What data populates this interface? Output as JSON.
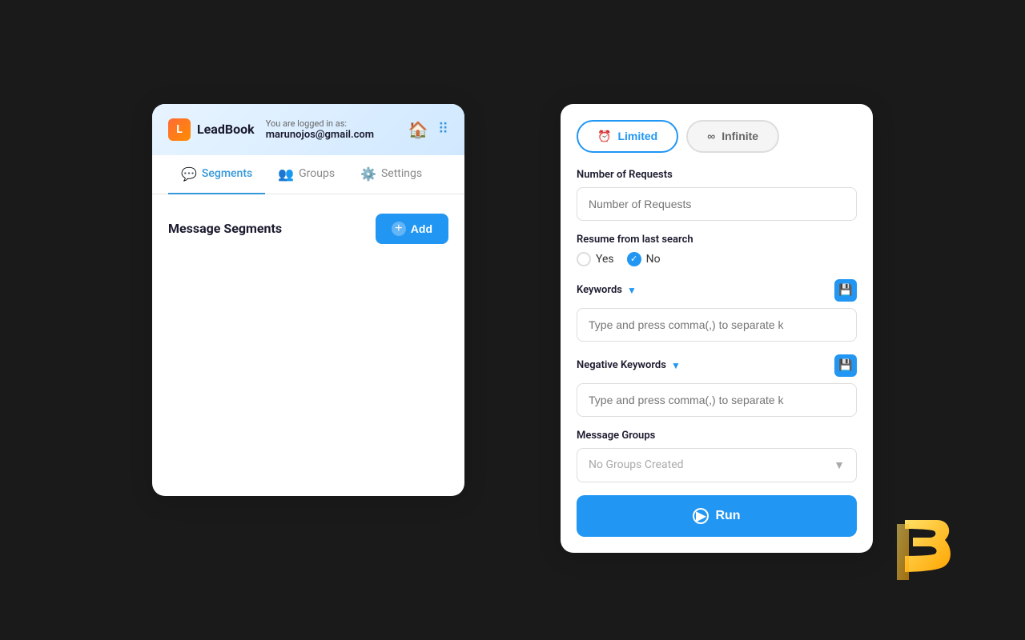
{
  "app": {
    "name": "LeadBook"
  },
  "header": {
    "logged_in_label": "You are logged in as:",
    "email": "marunojos@gmail.com"
  },
  "nav": {
    "tabs": [
      {
        "id": "segments",
        "label": "Segments",
        "active": true,
        "icon": "💬"
      },
      {
        "id": "groups",
        "label": "Groups",
        "active": false,
        "icon": "👥"
      },
      {
        "id": "settings",
        "label": "Settings",
        "active": false,
        "icon": "⚙️"
      }
    ]
  },
  "left_panel": {
    "section_title": "Message Segments",
    "add_button_label": "Add"
  },
  "right_panel": {
    "toggle": {
      "limited_label": "Limited",
      "infinite_label": "Infinite",
      "active": "limited"
    },
    "number_of_requests": {
      "label": "Number of Requests",
      "placeholder": "Number of Requests"
    },
    "resume": {
      "label": "Resume from last search",
      "yes_label": "Yes",
      "no_label": "No",
      "selected": "no"
    },
    "keywords": {
      "label": "Keywords",
      "placeholder": "Type and press comma(,) to separate k"
    },
    "negative_keywords": {
      "label": "Negative Keywords",
      "placeholder": "Type and press comma(,) to separate k"
    },
    "message_groups": {
      "label": "Message Groups",
      "placeholder": "No Groups Created"
    },
    "run_button_label": "Run"
  }
}
